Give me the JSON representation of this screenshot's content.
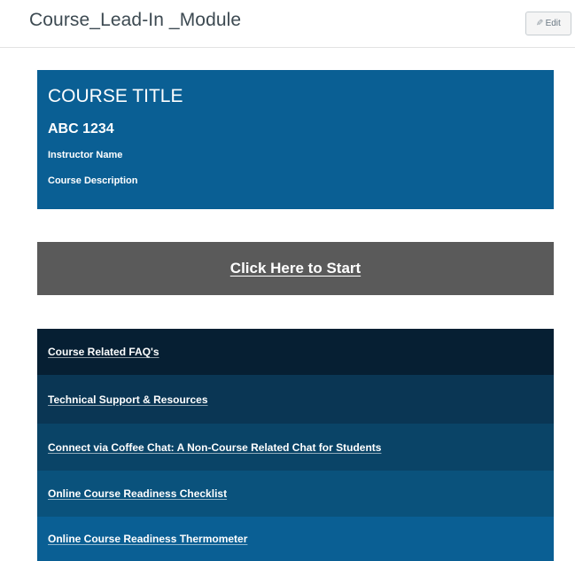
{
  "header": {
    "title": "Course_Lead-In _Module",
    "edit_label": "Edit",
    "edit_icon": "pencil-icon"
  },
  "course_banner": {
    "title": "COURSE TITLE",
    "code": "ABC 1234",
    "instructor": "Instructor Name",
    "description": "Course Description",
    "color": "#0a5f94"
  },
  "start_button": {
    "label": "Click Here to Start",
    "color": "#5a5a5a"
  },
  "resources": {
    "items": [
      {
        "label": "Course Related FAQ's",
        "color": "#061f33"
      },
      {
        "label": "Technical Support & Resources",
        "color": "#0a3654"
      },
      {
        "label": "Connect via Coffee Chat: A Non-Course Related Chat for Students",
        "color": "#0a4467"
      },
      {
        "label": "Online Course Readiness Checklist",
        "color": "#0a527c"
      },
      {
        "label": "Online Course Readiness Thermometer",
        "color": "#0a5f94"
      }
    ]
  }
}
